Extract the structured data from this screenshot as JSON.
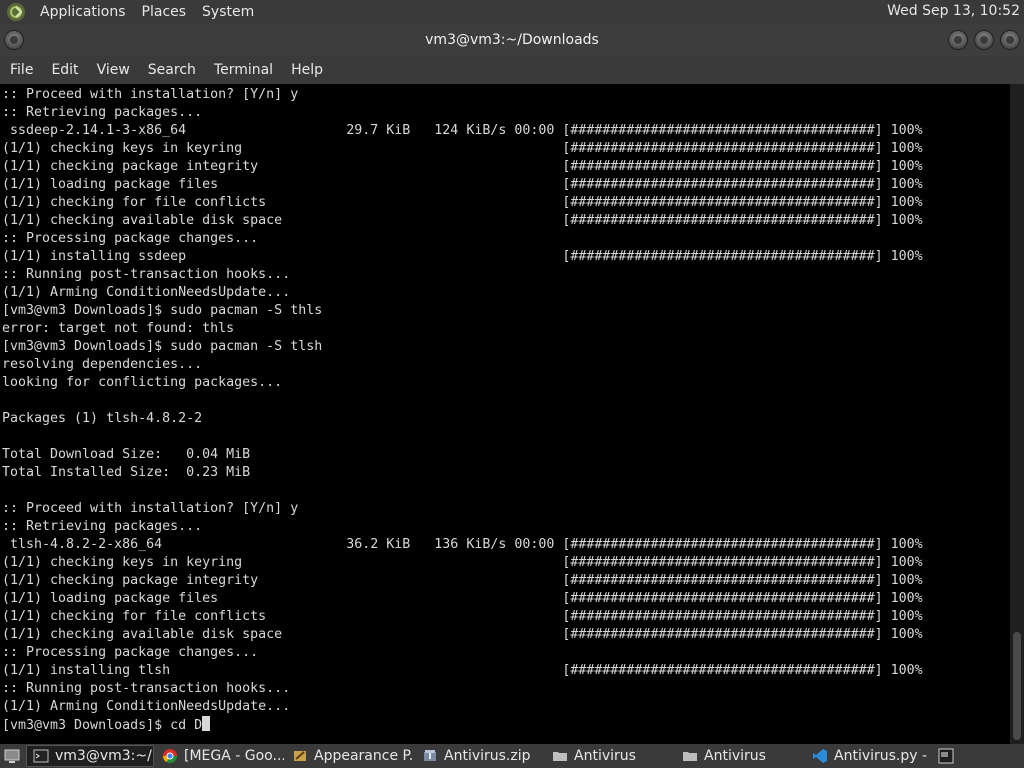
{
  "top_panel": {
    "menus": [
      "Applications",
      "Places",
      "System"
    ],
    "clock": "Wed Sep 13, 10:52"
  },
  "window": {
    "title": "vm3@vm3:~/Downloads",
    "menu": [
      "File",
      "Edit",
      "View",
      "Search",
      "Terminal",
      "Help"
    ]
  },
  "terminal": {
    "lines": [
      ":: Proceed with installation? [Y/n] y",
      ":: Retrieving packages...",
      " ssdeep-2.14.1-3-x86_64                    29.7 KiB   124 KiB/s 00:00 [######################################] 100%",
      "(1/1) checking keys in keyring                                        [######################################] 100%",
      "(1/1) checking package integrity                                      [######################################] 100%",
      "(1/1) loading package files                                           [######################################] 100%",
      "(1/1) checking for file conflicts                                     [######################################] 100%",
      "(1/1) checking available disk space                                   [######################################] 100%",
      ":: Processing package changes...",
      "(1/1) installing ssdeep                                               [######################################] 100%",
      ":: Running post-transaction hooks...",
      "(1/1) Arming ConditionNeedsUpdate...",
      "[vm3@vm3 Downloads]$ sudo pacman -S thls",
      "error: target not found: thls",
      "[vm3@vm3 Downloads]$ sudo pacman -S tlsh",
      "resolving dependencies...",
      "looking for conflicting packages...",
      "",
      "Packages (1) tlsh-4.8.2-2",
      "",
      "Total Download Size:   0.04 MiB",
      "Total Installed Size:  0.23 MiB",
      "",
      ":: Proceed with installation? [Y/n] y",
      ":: Retrieving packages...",
      " tlsh-4.8.2-2-x86_64                       36.2 KiB   136 KiB/s 00:00 [######################################] 100%",
      "(1/1) checking keys in keyring                                        [######################################] 100%",
      "(1/1) checking package integrity                                      [######################################] 100%",
      "(1/1) loading package files                                           [######################################] 100%",
      "(1/1) checking for file conflicts                                     [######################################] 100%",
      "(1/1) checking available disk space                                   [######################################] 100%",
      ":: Processing package changes...",
      "(1/1) installing tlsh                                                 [######################################] 100%",
      ":: Running post-transaction hooks...",
      "(1/1) Arming ConditionNeedsUpdate..."
    ],
    "prompt": "[vm3@vm3 Downloads]$ cd D"
  },
  "taskbar": {
    "items": [
      {
        "label": "vm3@vm3:~/...",
        "icon": "terminal-icon"
      },
      {
        "label": "[MEGA - Goo...",
        "icon": "chrome-icon"
      },
      {
        "label": "Appearance P...",
        "icon": "appearance-icon"
      },
      {
        "label": "Antivirus.zip",
        "icon": "archive-icon"
      },
      {
        "label": "Antivirus",
        "icon": "folder-icon"
      },
      {
        "label": "Antivirus",
        "icon": "folder-icon"
      },
      {
        "label": "Antivirus.py - ...",
        "icon": "vscode-icon"
      }
    ]
  },
  "colors": {
    "panel_bg": "#3a3a3a",
    "terminal_bg": "#000000",
    "terminal_fg": "#d8d8d8"
  }
}
